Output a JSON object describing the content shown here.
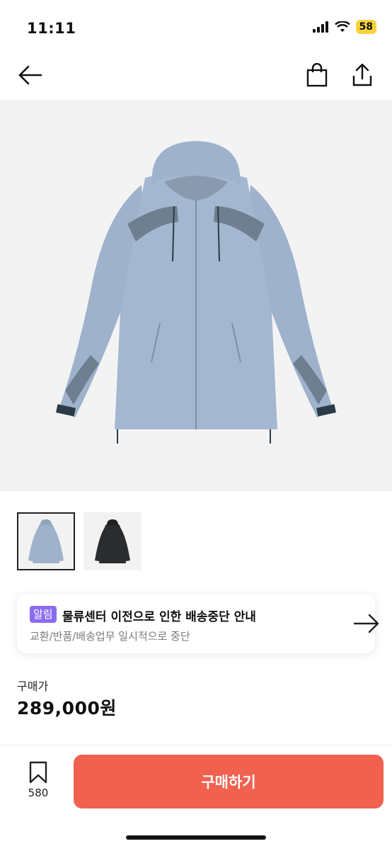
{
  "status_bar": {
    "time": "11:11",
    "battery": "58"
  },
  "nav": {
    "back_icon": "arrow-left-icon",
    "bag_icon": "shopping-bag-icon",
    "share_icon": "share-icon"
  },
  "product": {
    "hero_colors": {
      "jacket": "#9eb2cc",
      "panel": "#6f7f8f",
      "background": "#f3f3f4"
    },
    "thumbnails": [
      {
        "color": "#9eb2cc",
        "selected": true
      },
      {
        "color": "#2b2c2e",
        "selected": false
      }
    ]
  },
  "notice": {
    "badge": "알림",
    "title": "물류센터 이전으로 인한 배송중단 안내",
    "subtitle": "교환/반품/배송업무 일시적으로 중단",
    "badge_color": "#8b6cf0"
  },
  "price": {
    "label": "구매가",
    "value": "289,000원"
  },
  "bottom": {
    "wishlist_count": "580",
    "buy_label": "구매하기",
    "buy_color": "#f0614f"
  }
}
